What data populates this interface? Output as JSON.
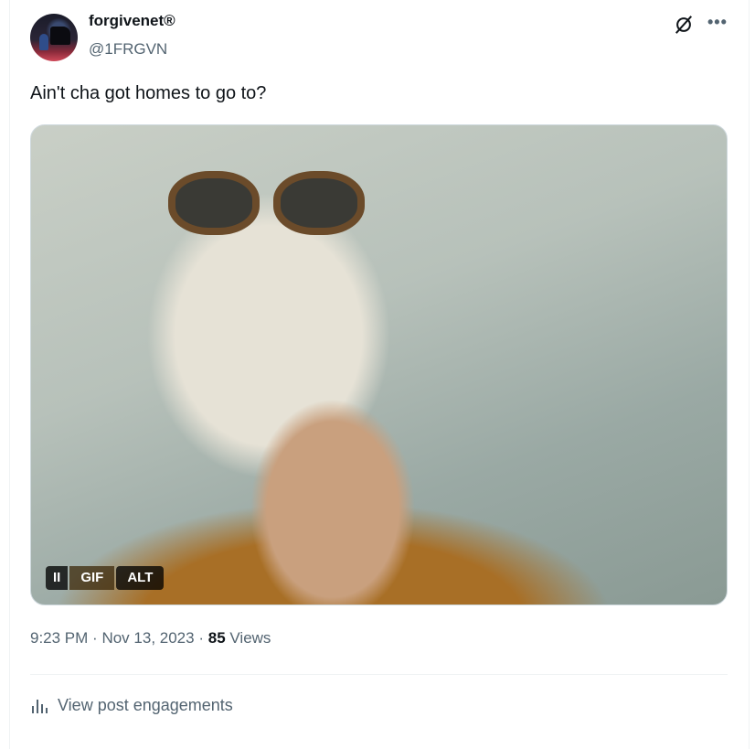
{
  "author": {
    "display_name": "forgivenet®",
    "handle": "@1FRGVN",
    "avatar_icon": "avatar-photo"
  },
  "header_actions": {
    "grok_icon": "grok-icon",
    "more_icon": "more-icon",
    "more_glyph": "•••"
  },
  "post": {
    "text": "Ain't cha got homes to go to?"
  },
  "media": {
    "type": "GIF",
    "pause_glyph": "II",
    "gif_label": "GIF",
    "alt_label": "ALT"
  },
  "meta": {
    "time": "9:23 PM",
    "sep": "·",
    "date": "Nov 13, 2023",
    "views_count": "85",
    "views_label": "Views"
  },
  "engagements": {
    "label": "View post engagements",
    "icon": "bar-chart-icon"
  },
  "colors": {
    "text": "#0f1419",
    "secondary": "#536471",
    "border": "#eff3f4"
  }
}
